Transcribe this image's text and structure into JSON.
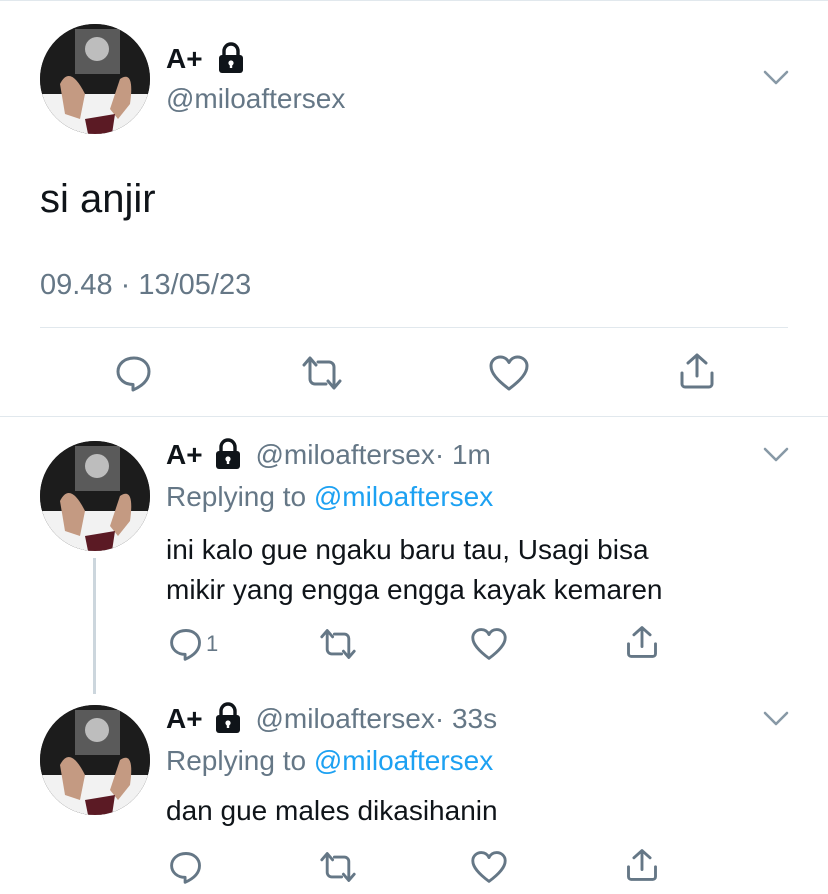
{
  "main_tweet": {
    "display_name": "A+",
    "handle": "@miloaftersex",
    "text": "si anjir",
    "timestamp": "09.48 · 13/05/23",
    "icons": [
      "lock-icon",
      "chevron-down-icon",
      "reply-icon",
      "retweet-icon",
      "like-icon",
      "share-icon"
    ]
  },
  "replies": [
    {
      "display_name": "A+",
      "handle": "@miloaftersex",
      "time": "· 1m",
      "replying_prefix": "Replying to",
      "replying_handle": "@miloaftersex",
      "text_line1": "ini kalo gue ngaku baru tau, Usagi bisa",
      "text_line2": "mikir yang engga engga kayak kemaren",
      "reply_count": "1"
    },
    {
      "display_name": "A+",
      "handle": "@miloaftersex",
      "time": "· 33s",
      "replying_prefix": "Replying to",
      "replying_handle": "@miloaftersex",
      "text_line1": "dan gue males dikasihanin",
      "reply_count": ""
    }
  ],
  "colors": {
    "accent": "#1da1f2",
    "muted": "#657786",
    "divider": "#e1e8ed",
    "text": "#0f1419"
  }
}
